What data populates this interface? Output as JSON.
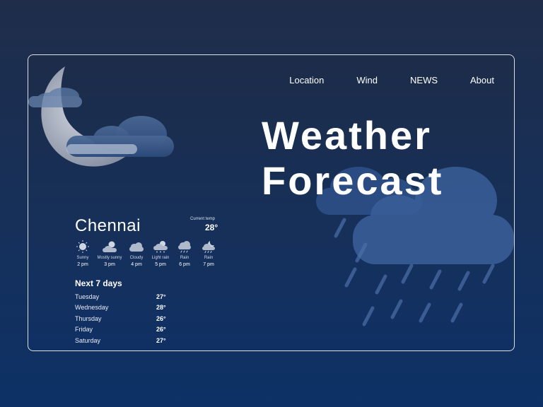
{
  "nav": [
    "Location",
    "Wind",
    "NEWS",
    "About"
  ],
  "headline": [
    "Weather",
    "Forecast"
  ],
  "city": "Chennai",
  "current": {
    "label": "Current temp",
    "temp": "28°"
  },
  "hourly": [
    {
      "icon": "sun-icon",
      "condition": "Sunny",
      "time": "2 pm"
    },
    {
      "icon": "partly-sunny-icon",
      "condition": "Mostly sunny",
      "time": "3 pm"
    },
    {
      "icon": "cloud-icon",
      "condition": "Cloudy",
      "time": "4 pm"
    },
    {
      "icon": "light-rain-icon",
      "condition": "Light rain",
      "time": "5 pm"
    },
    {
      "icon": "rain-icon",
      "condition": "Rain",
      "time": "6 pm"
    },
    {
      "icon": "night-rain-icon",
      "condition": "Rain",
      "time": "7 pm"
    }
  ],
  "next_days": {
    "title": "Next 7 days",
    "days": [
      {
        "day": "Tuesday",
        "temp": "27°"
      },
      {
        "day": "Wednesday",
        "temp": "28°"
      },
      {
        "day": "Thursday",
        "temp": "26°"
      },
      {
        "day": "Friday",
        "temp": "26°"
      },
      {
        "day": "Saturday",
        "temp": "27°"
      }
    ]
  },
  "colors": {
    "background": "#16305a",
    "text": "#ffffff",
    "border": "#ffffff"
  }
}
